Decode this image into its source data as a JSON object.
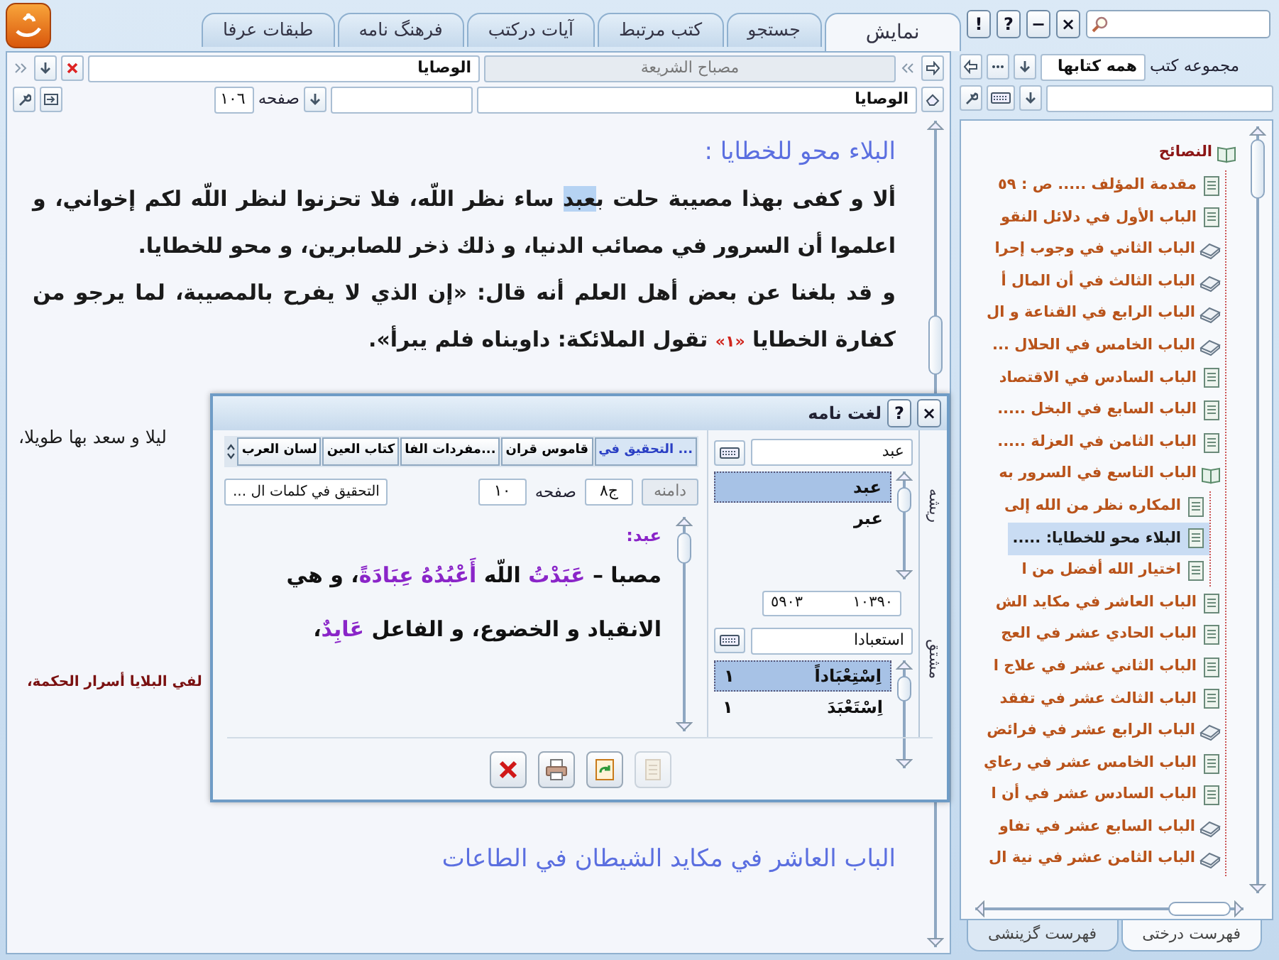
{
  "window": {
    "tabs": [
      {
        "label": "نمایش",
        "selected": true
      },
      {
        "label": "جستجو",
        "selected": false
      },
      {
        "label": "کتب مرتبط",
        "selected": false
      },
      {
        "label": "آیات درکتب",
        "selected": false
      },
      {
        "label": "فرهنگ نامه",
        "selected": false
      },
      {
        "label": "طبقات عرفا",
        "selected": false
      }
    ],
    "buttons": [
      "×",
      "−",
      "?",
      "!"
    ]
  },
  "library": {
    "label": "مجموعه کتب",
    "collection": "همه کتابها"
  },
  "tree": {
    "items": [
      {
        "label": "النصائح",
        "kind": "book",
        "expanded": true,
        "selected": false,
        "children": [
          {
            "label": "مقدمة المؤلف ..... ص : ٥٩",
            "kind": "page",
            "selected": false
          },
          {
            "label": "الباب الأول في دلائل النقو",
            "kind": "page",
            "selected": false
          },
          {
            "label": "الباب الثاني في وجوب إحرا",
            "kind": "book",
            "selected": false
          },
          {
            "label": "الباب الثالث في أن المال أ",
            "kind": "book",
            "selected": false
          },
          {
            "label": "الباب الرابع في القناعة و ال",
            "kind": "book",
            "selected": false
          },
          {
            "label": "الباب الخامس في الحلال ...",
            "kind": "book",
            "selected": false
          },
          {
            "label": "الباب السادس في الاقتصاد",
            "kind": "page",
            "selected": false
          },
          {
            "label": "الباب السابع في البخل .....",
            "kind": "page",
            "selected": false
          },
          {
            "label": "الباب الثامن في العزلة .....",
            "kind": "page",
            "selected": false
          },
          {
            "label": "الباب التاسع في السرور به",
            "kind": "book",
            "expanded": true,
            "selected": false,
            "children": [
              {
                "label": "المكاره نظر من الله إلى",
                "kind": "page",
                "selected": false
              },
              {
                "label": "البلاء محو للخطايا: .....",
                "kind": "page",
                "selected": true
              },
              {
                "label": "اختيار الله أفضل من ا",
                "kind": "page",
                "selected": false
              }
            ]
          },
          {
            "label": "الباب العاشر في مكايد الش",
            "kind": "page",
            "selected": false
          },
          {
            "label": "الباب الحادي عشر في العج",
            "kind": "page",
            "selected": false
          },
          {
            "label": "الباب الثاني عشر في علاج ا",
            "kind": "page",
            "selected": false
          },
          {
            "label": "الباب الثالث عشر في تفقد",
            "kind": "page",
            "selected": false
          },
          {
            "label": "الباب الرابع عشر في فرائض",
            "kind": "book",
            "selected": false
          },
          {
            "label": "الباب الخامس عشر في رعاي",
            "kind": "page",
            "selected": false
          },
          {
            "label": "الباب السادس عشر في أن ا",
            "kind": "page",
            "selected": false
          },
          {
            "label": "الباب السابع عشر في تفاو",
            "kind": "book",
            "selected": false
          },
          {
            "label": "الباب الثامن عشر في نية ال",
            "kind": "book",
            "selected": false
          }
        ]
      }
    ]
  },
  "tree_tabs": [
    {
      "label": "فهرست درختی",
      "selected": true
    },
    {
      "label": "فهرست گزینشی",
      "selected": false
    }
  ],
  "reader": {
    "section": "الوصايا",
    "book": "مصباح الشريعة",
    "section_field": "الوصايا",
    "page_label": "صفحه",
    "page": "١٠٦",
    "blocks": [
      {
        "kind": "heading",
        "text": "البلاء محو للخطايا :"
      },
      {
        "kind": "paragraph",
        "segments": [
          {
            "kind": "plain",
            "text": "ألا و كفى بهذا مصيبة حلت ب"
          },
          {
            "kind": "selection",
            "text": "عبد"
          },
          {
            "kind": "plain",
            "text": " ساء نظر اللّه، فلا تحزنوا لنظر اللّه لكم إخواني، و اعلموا أن السرور في مصائب الدنيا، و ذلك ذخر للصابرين، و محو للخطايا."
          }
        ]
      },
      {
        "kind": "paragraph",
        "segments": [
          {
            "kind": "plain",
            "text": "و قد بلغنا عن بعض أهل العلم أنه قال: «إن الذي لا يفرح بالمصيبة، لما يرجو من كفارة الخطايا "
          },
          {
            "kind": "note",
            "text": "«١»"
          },
          {
            "kind": "plain",
            "text": " تقول الملائكة: داويناه فلم يبرأ»."
          }
        ]
      },
      {
        "kind": "fragment",
        "text": "ليلا و سعد بها طويلا،"
      },
      {
        "kind": "quote_fragment",
        "text": "لفي البلايا أسرار الحكمة،"
      },
      {
        "kind": "heading",
        "text": "الباب العاشر في مكايد الشيطان في الطاعات"
      }
    ]
  },
  "dictionary": {
    "title": "لغت نامه",
    "buttons": [
      "×",
      "?"
    ],
    "side_tabs": [
      "ریشه",
      "مشتق"
    ],
    "root_field": "عبد",
    "roots": [
      {
        "text": "عبد",
        "selected": true
      },
      {
        "text": "عبر",
        "selected": false
      }
    ],
    "counts": [
      "١٠٣٩٠",
      "٥٩٠٣"
    ],
    "derived_field": "استعبادا",
    "derivatives": [
      {
        "text": "اِسْتِعْبَاداً",
        "count": "١",
        "selected": true
      },
      {
        "text": "اِسْتَعْبَدَ",
        "count": "١",
        "selected": false
      }
    ],
    "dict_tabs": [
      {
        "label": "التحقيق في ...",
        "selected": true
      },
      {
        "label": "قاموس قران",
        "selected": false
      },
      {
        "label": "مفردات الفا...",
        "selected": false
      },
      {
        "label": "كتاب العين",
        "selected": false
      },
      {
        "label": "لسان العرب",
        "selected": false
      }
    ],
    "scope_label": "دامنه",
    "volume": "ج٨",
    "page_label": "صفحه",
    "page": "١٠",
    "source": "التحقيق في كلمات ال ...",
    "entry": {
      "headword": "عبد:",
      "segments": [
        {
          "kind": "plain",
          "text": "مصبا – "
        },
        {
          "kind": "term",
          "text": "عَبَدْتُ"
        },
        {
          "kind": "plain",
          "text": " اللّه "
        },
        {
          "kind": "term",
          "text": "أَعْبُدُهُ عِبَادَةً"
        },
        {
          "kind": "plain",
          "text": "، و هي الانقياد و الخضوع، و الفاعل "
        },
        {
          "kind": "term",
          "text": "عَابِدٌ"
        },
        {
          "kind": "plain",
          "text": "،"
        }
      ]
    },
    "actions": [
      {
        "kind": "close",
        "disabled": false
      },
      {
        "kind": "print",
        "disabled": false
      },
      {
        "kind": "refresh",
        "disabled": false
      },
      {
        "kind": "document",
        "disabled": true
      }
    ]
  }
}
